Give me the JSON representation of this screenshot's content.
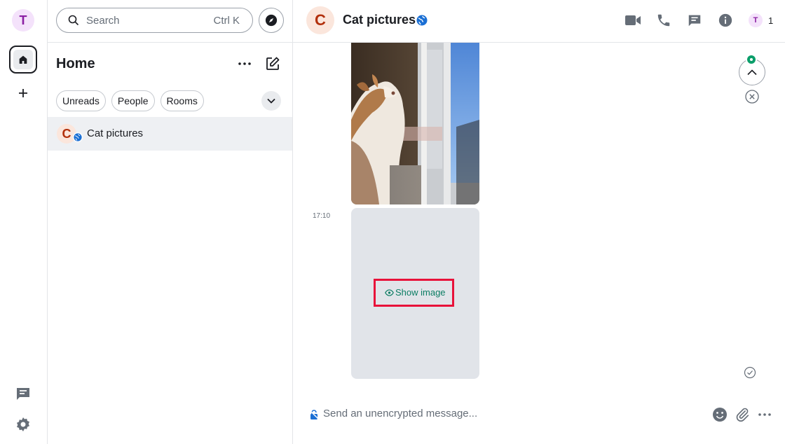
{
  "spacebar": {
    "user_initial": "T"
  },
  "roomlist": {
    "search_placeholder": "Search",
    "search_shortcut": "Ctrl K",
    "title": "Home",
    "filters": [
      "Unreads",
      "People",
      "Rooms"
    ],
    "rooms": [
      {
        "initial": "C",
        "name": "Cat pictures"
      }
    ]
  },
  "room": {
    "initial": "C",
    "name": "Cat pictures",
    "member_initial": "T",
    "member_count": "1"
  },
  "timeline": {
    "timestamp": "17:10",
    "show_image_label": "Show image"
  },
  "composer": {
    "placeholder": "Send an unencrypted message..."
  },
  "colors": {
    "accent": "#0b7d63",
    "highlight": "#e8123a",
    "room_avatar_bg": "#fbe6dc",
    "room_avatar_fg": "#b2300c",
    "user_avatar_bg": "#f4e2fb",
    "user_avatar_fg": "#8b1fa3"
  }
}
